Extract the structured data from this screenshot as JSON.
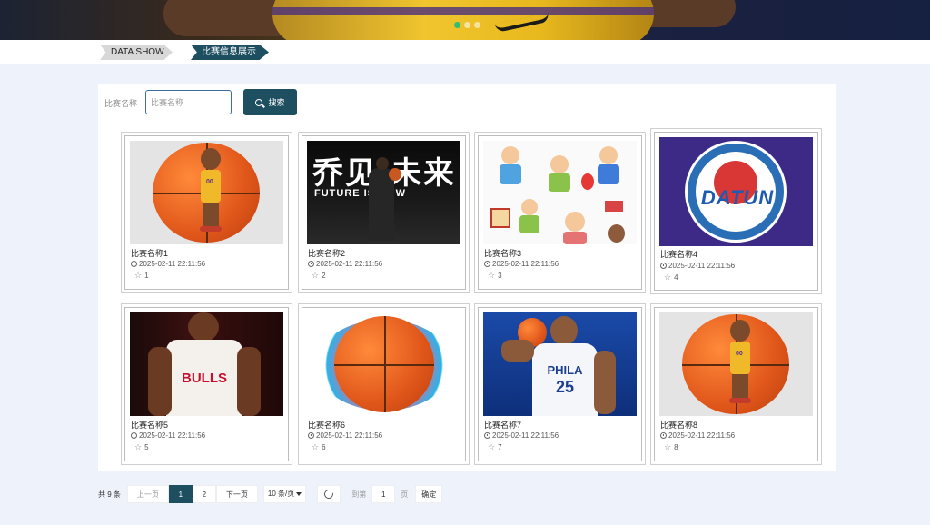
{
  "banner": {
    "carousel_dots": 3,
    "active_dot": 1
  },
  "breadcrumb": {
    "home": "DATA SHOW",
    "current": "比赛信息展示"
  },
  "search": {
    "label": "比赛名称",
    "placeholder": "比赛名称",
    "value": "",
    "button_label": "搜索"
  },
  "cards": [
    {
      "title": "比赛名称1",
      "time": "2025-02-11 22:11:56",
      "likes": "1",
      "image": "cartoon-basketball-player"
    },
    {
      "title": "比赛名称2",
      "time": "2025-02-11 22:11:56",
      "likes": "2",
      "image": "future-is-now-poster",
      "poster_text_cn": "乔见 未来",
      "poster_text_en": "FUTURE IS NOW"
    },
    {
      "title": "比赛名称3",
      "time": "2025-02-11 22:11:56",
      "likes": "3",
      "image": "cartoon-children"
    },
    {
      "title": "比赛名称4",
      "time": "2025-02-11 22:11:56",
      "likes": "4",
      "image": "datun-logo",
      "logo_text": "DATUN"
    },
    {
      "title": "比赛名称5",
      "time": "2025-02-11 22:11:56",
      "likes": "5",
      "image": "bulls-player",
      "jersey_text": "BULLS"
    },
    {
      "title": "比赛名称6",
      "time": "2025-02-11 22:11:56",
      "likes": "6",
      "image": "painted-basketball"
    },
    {
      "title": "比赛名称7",
      "time": "2025-02-11 22:11:56",
      "likes": "7",
      "image": "phila-player",
      "jersey_text": "PHILA",
      "jersey_number": "25"
    },
    {
      "title": "比赛名称8",
      "time": "2025-02-11 22:11:56",
      "likes": "8",
      "image": "cartoon-basketball-player"
    }
  ],
  "pagination": {
    "total": "共 9 条",
    "prev": "上一页",
    "pages": [
      "1",
      "2"
    ],
    "active_page": "1",
    "next": "下一页",
    "page_size": "10 条/页",
    "goto_label": "到第",
    "goto_value": "1",
    "page_unit": "页",
    "confirm": "确定"
  },
  "colors": {
    "primary": "#1e4f60",
    "background": "#eef2fb",
    "dot_active": "#2fbf73"
  }
}
